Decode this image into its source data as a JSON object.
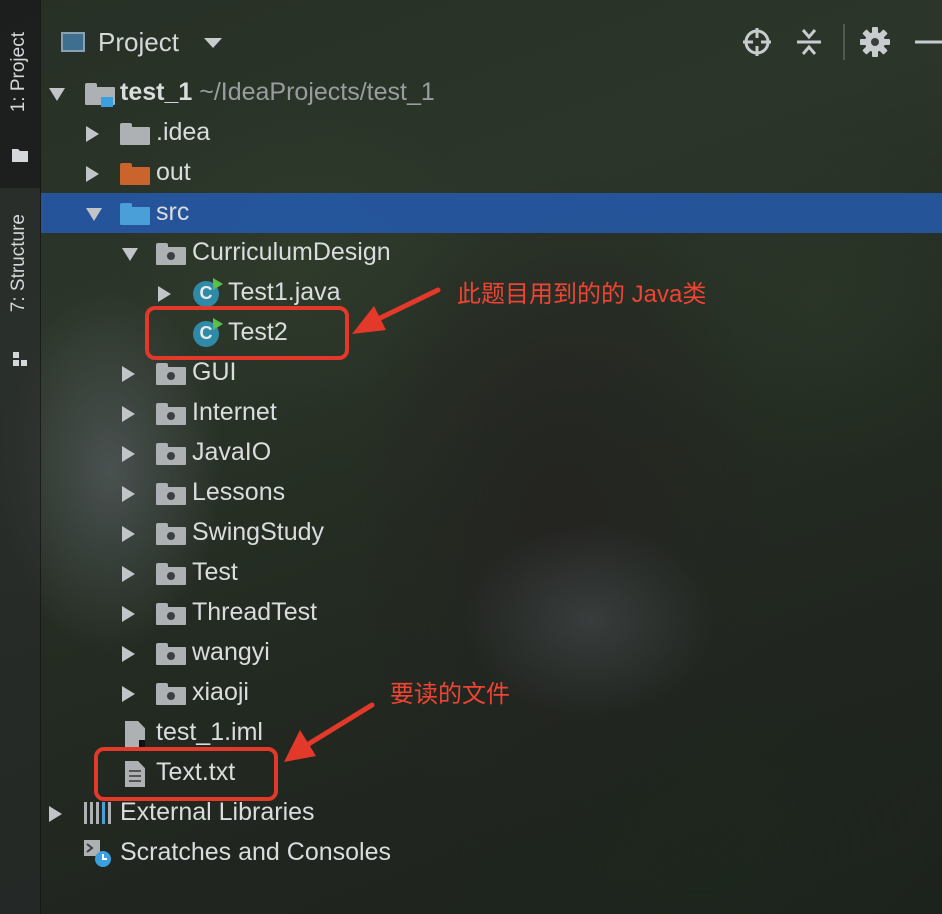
{
  "toolwindow_strip": {
    "tabs": [
      {
        "label": "1: Project",
        "active": true
      },
      {
        "label": "7: Structure",
        "active": false
      }
    ]
  },
  "header": {
    "title": "Project",
    "buttons": [
      "locate-icon",
      "collapse-all-icon",
      "gear-icon",
      "minimize-icon"
    ]
  },
  "tree": {
    "root": {
      "label": "test_1",
      "path": "~/IdeaProjects/test_1"
    },
    "items": {
      "idea": ".idea",
      "out": "out",
      "src": "src",
      "curriculum": "CurriculumDesign",
      "test1java": "Test1.java",
      "test2": "Test2",
      "gui": "GUI",
      "internet": "Internet",
      "javaio": "JavaIO",
      "lessons": "Lessons",
      "swingstudy": "SwingStudy",
      "test": "Test",
      "threadtest": "ThreadTest",
      "wangyi": "wangyi",
      "xiaoji": "xiaoji",
      "iml": "test_1.iml",
      "texttxt": "Text.txt",
      "extlibs": "External Libraries",
      "scratches": "Scratches and Consoles"
    },
    "selected": "src"
  },
  "annotations": {
    "java_class": "此题目用到的的 Java类",
    "file_to_read": "要读的文件",
    "color": "#e2392b"
  },
  "colors": {
    "selection": "#2459aa",
    "folder_blue": "#4a9fd8",
    "folder_orange": "#c8642c",
    "folder_gray": "#aeb1b4",
    "class_icon": "#2f8aa8"
  }
}
